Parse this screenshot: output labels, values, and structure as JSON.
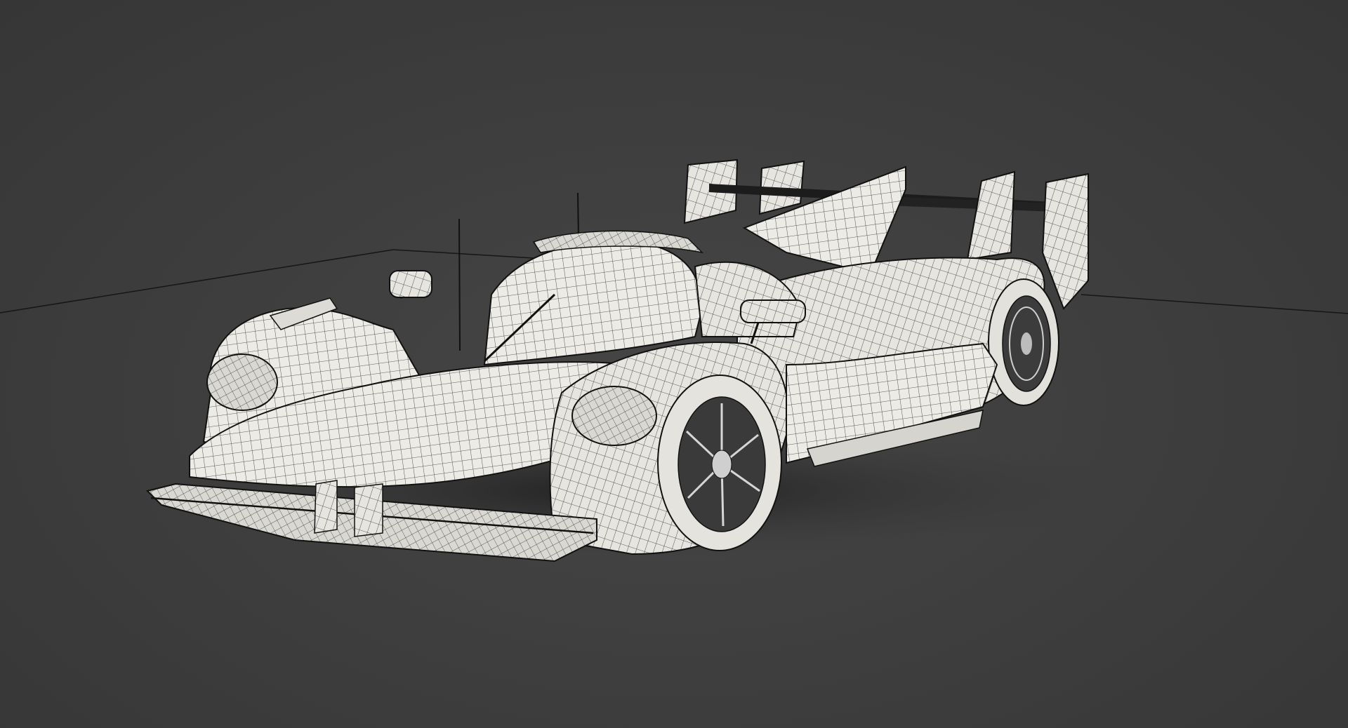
{
  "scene": {
    "subject": "race-car-wireframe-render",
    "colors": {
      "background": "#3f3f3f",
      "floor_line": "#1a1a1a",
      "body_fill": "#ecebe6",
      "body_shade": "#cfcec8",
      "wire": "#2b2b2b",
      "tire": "#e4e3de",
      "shadow": "#262626"
    },
    "shading_mode": "wireframe-on-shaded"
  }
}
